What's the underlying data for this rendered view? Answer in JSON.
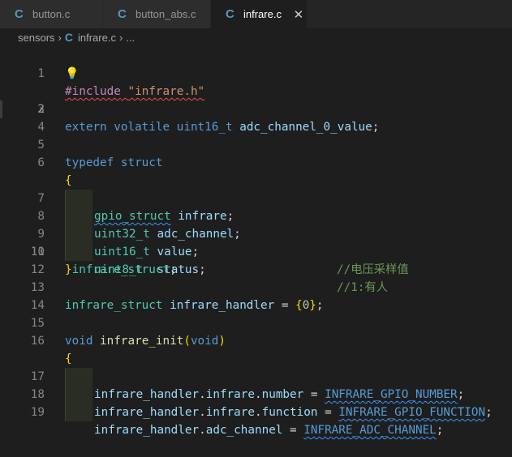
{
  "tabs": [
    {
      "label": "button.c",
      "icon": "c-file-icon",
      "active": false
    },
    {
      "label": "button_abs.c",
      "icon": "c-file-icon",
      "active": false
    },
    {
      "label": "infrare.c",
      "icon": "c-file-icon",
      "active": true
    }
  ],
  "close_glyph": "✕",
  "breadcrumb": {
    "folder": "sensors",
    "file": "infrare.c",
    "more": "...",
    "sep": "›"
  },
  "lines": {
    "n1": "1",
    "n2": "2",
    "n3": "3",
    "n4": "4",
    "n5": "5",
    "n6": "6",
    "n7": "7",
    "n8": "8",
    "n9": "9",
    "n10": "10",
    "n11": "11",
    "n12": "12",
    "n13": "13",
    "n14": "14",
    "n15": "15",
    "n16": "16",
    "n17": "17",
    "n18": "18",
    "n19": "19"
  },
  "code": {
    "l1_inc": "#include",
    "l1_str": "\"infrare.h\"",
    "l3_kw": "extern volatile",
    "l3_ty": "uint16_t",
    "l3_var": "adc_channel_0_value",
    "l5_kw": "typedef struct",
    "l6_brace": "{",
    "l7_ty": "gpio_struct",
    "l7_var": "infrare",
    "l8_ty": "uint32_t",
    "l8_var": "adc_channel",
    "l9_ty": "uint16_t",
    "l9_var": "value",
    "l9_cm": "//电压采样值",
    "l10_ty": "uint8_t",
    "l10_var": "status",
    "l10_cm": "//1:有人",
    "l11_brace": "}",
    "l11_ty": "infrare_struct",
    "l13_ty": "infrare_struct",
    "l13_var": "infrare_handler",
    "l13_num": "0",
    "l15_kw": "void",
    "l15_fn": "infrare_init",
    "l15_arg": "void",
    "l16_brace": "{",
    "l17_a": "infrare_handler",
    "l17_b": "infrare",
    "l17_c": "number",
    "l17_mac": "INFRARE_GPIO_NUMBER",
    "l18_a": "infrare_handler",
    "l18_b": "infrare",
    "l18_c": "function",
    "l18_mac": "INFRARE_GPIO_FUNCTION",
    "l19_a": "infrare_handler",
    "l19_c": "adc_channel",
    "l19_mac": "INFRARE_ADC_CHANNEL"
  },
  "colors": {
    "background": "#1e1e1e",
    "keyword": "#569cd6",
    "type": "#4ec9b0",
    "variable": "#9cdcfe",
    "comment": "#6a9955",
    "string": "#ce9178",
    "c_icon": "#519aba"
  }
}
